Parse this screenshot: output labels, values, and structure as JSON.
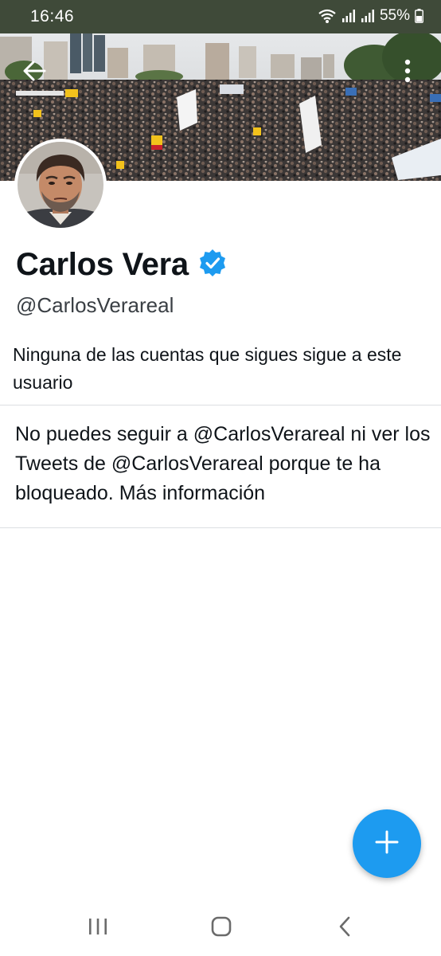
{
  "status_bar": {
    "time": "16:46",
    "battery": "55%",
    "icons": [
      "wifi-icon",
      "signal-icon",
      "signal-icon",
      "battery-icon"
    ]
  },
  "header": {
    "back_icon": "arrow-left-icon",
    "more_icon": "more-vertical-icon"
  },
  "profile": {
    "display_name": "Carlos Vera",
    "handle": "@CarlosVerareal",
    "verified_icon": "verified-badge-icon",
    "followers_you_know": "Ninguna de las cuentas que sigues sigue a este usuario"
  },
  "blocked": {
    "message": "No puedes seguir a @CarlosVerareal ni ver los Tweets de @CarlosVerareal porque te ha bloqueado.",
    "link_label": "Más información"
  },
  "fab": {
    "icon": "plus-icon"
  },
  "nav_bar": {
    "recents_icon": "recent-apps-icon",
    "home_icon": "home-icon",
    "back_icon": "back-icon"
  },
  "colors": {
    "accent": "#1d9bf0",
    "status_bar_bg": "#3f4a39",
    "text_primary": "#0f1419",
    "text_secondary": "#3a3f44"
  }
}
